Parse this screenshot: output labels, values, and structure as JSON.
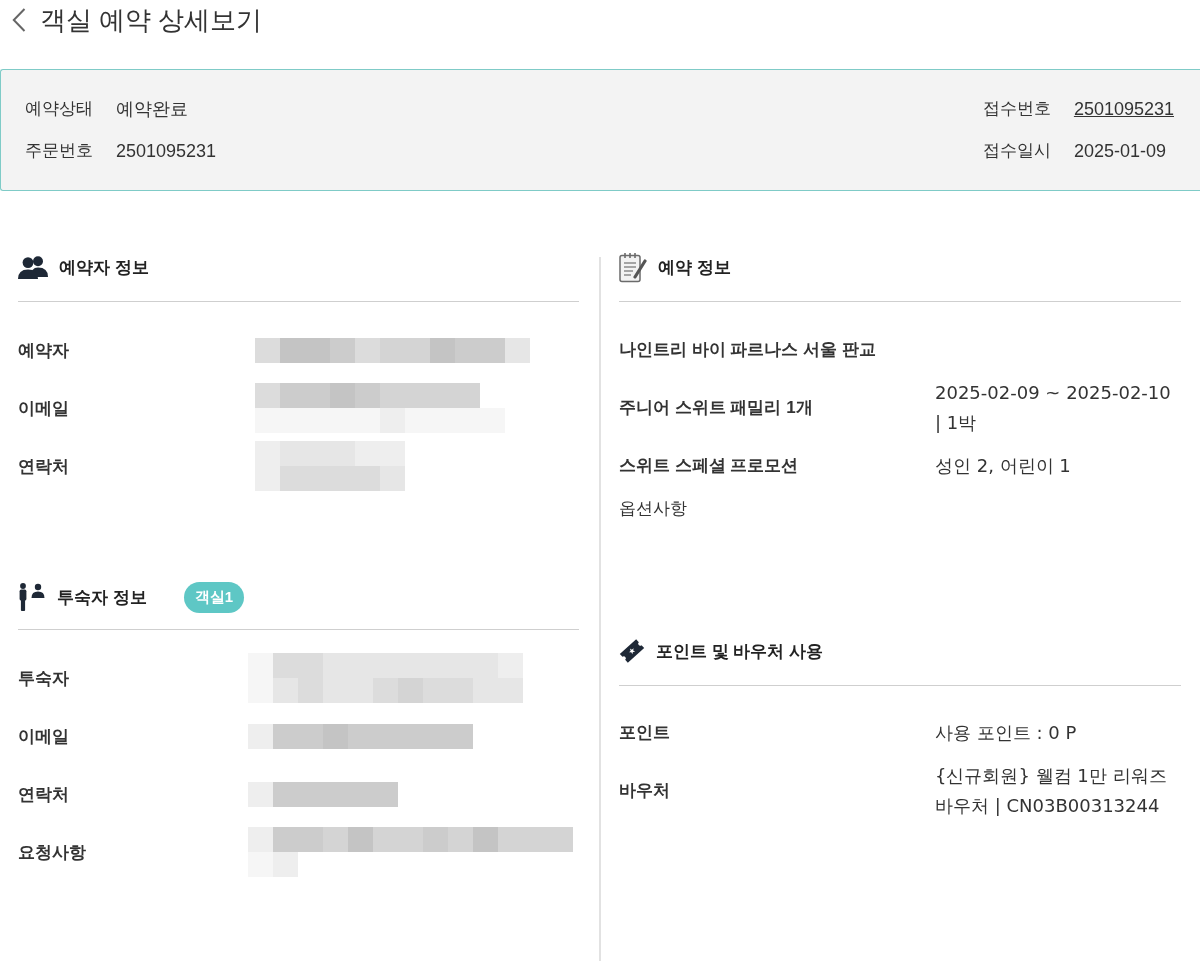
{
  "header": {
    "title": "객실 예약 상세보기"
  },
  "summary": {
    "left": [
      {
        "kind": "text",
        "label": "예약상태",
        "value": "예약완료"
      },
      {
        "kind": "text",
        "label": "주문번호",
        "value": "2501095231"
      }
    ],
    "right": [
      {
        "kind": "link",
        "label": "접수번호",
        "value": "2501095231"
      },
      {
        "kind": "text",
        "label": "접수일시",
        "value": "2025-01-09"
      }
    ]
  },
  "booker_info": {
    "title": "예약자 정보",
    "rows": [
      {
        "label": "예약자",
        "redacted": true
      },
      {
        "label": "이메일",
        "redacted": true
      },
      {
        "label": "연락처",
        "redacted": true
      }
    ]
  },
  "guest_info": {
    "title": "투숙자 정보",
    "badge": "객실1",
    "rows": [
      {
        "label": "투숙자",
        "redacted": true
      },
      {
        "label": "이메일",
        "redacted": true
      },
      {
        "label": "연락처",
        "redacted": true
      },
      {
        "label": "요청사항",
        "redacted": true
      }
    ]
  },
  "reservation_info": {
    "title": "예약 정보",
    "rows": [
      {
        "kind": "hotel",
        "label": "나인트리 바이 파르나스 서울 판교"
      },
      {
        "kind": "pair",
        "label": "주니어 스위트 패밀리 1개",
        "value": "2025-02-09 ~ 2025-02-10 | 1박"
      },
      {
        "kind": "pair",
        "label": "스위트 스페셜 프로모션",
        "value": "성인 2, 어린이 1"
      },
      {
        "kind": "plain",
        "label": "옵션사항"
      }
    ]
  },
  "points_vouchers": {
    "title": "포인트 및 바우처 사용",
    "rows": [
      {
        "kind": "pair",
        "label": "포인트",
        "value": "사용 포인트 : 0 P"
      },
      {
        "kind": "pair",
        "label": "바우처",
        "value": "{신규회원} 웰컴 1만 리워즈 바우처 | CN03B00313244"
      }
    ]
  }
}
